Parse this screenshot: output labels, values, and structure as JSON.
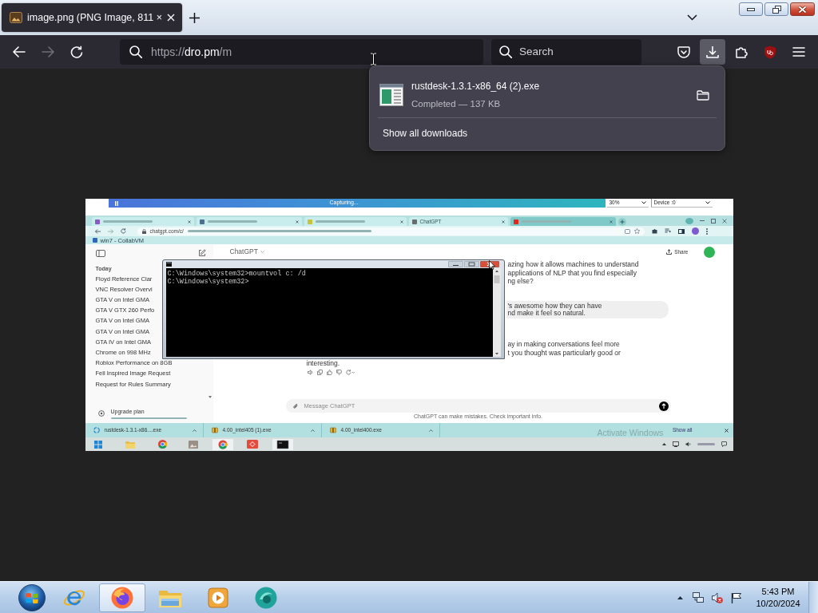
{
  "tab_strip": {
    "tabs": [
      {
        "title": "image.png (PNG Image, 811 ×",
        "selected": true
      }
    ]
  },
  "nav_buttons": [
    {
      "kind": "back",
      "disabled": false
    },
    {
      "kind": "forward",
      "disabled": true
    },
    {
      "kind": "reload",
      "disabled": false
    }
  ],
  "address_bar": {
    "scheme": "https://",
    "host": "dro.pm",
    "path": "/m"
  },
  "search_bar": {
    "placeholder": "Search"
  },
  "toolbar_buttons": [
    {
      "kind": "pocket",
      "selected": false
    },
    {
      "kind": "downloads",
      "selected": true
    },
    {
      "kind": "extensions",
      "selected": false
    },
    {
      "kind": "ublock",
      "selected": false
    },
    {
      "kind": "menu",
      "selected": false
    }
  ],
  "downloads_panel": {
    "items": [
      {
        "filename": "rustdesk-1.3.1-x86_64 (2).exe",
        "status": "Completed — 137 KB"
      }
    ],
    "footer": "Show all downloads"
  },
  "screenshot": {
    "capture_bar": {
      "status": "Capturing...",
      "zoom": "30%",
      "device": "Device :0"
    },
    "browser_tabs": [
      {
        "color": "#8a5bc4",
        "highlighted": false
      },
      {
        "color": "#4f6f8f",
        "highlighted": false
      },
      {
        "color": "#c9c23a",
        "highlighted": false
      },
      {
        "title": "ChatGPT",
        "color": "#6b6b6b",
        "highlighted": false
      },
      {
        "color": "#e0271f",
        "highlighted": true
      }
    ],
    "address": {
      "url": "chatgpt.com/c/"
    },
    "bookmarks": [
      {
        "title": "win7 - CollabVM"
      }
    ],
    "sidebar": {
      "section": "Today",
      "items": [
        "Floyd Reference Clar",
        "VNC Resolver Overvi",
        "GTA V on Intel GMA",
        "GTA V GTX 260 Perfo",
        "GTA V on Intel GMA",
        "GTA V on Intel GMA",
        "GTA IV on Intel GMA",
        "Chrome on 998 MHz",
        "Roblox Performance on 8GB",
        "Fell Inspired Image Request",
        "Request for Rules Summary"
      ],
      "upgrade": "Upgrade plan"
    },
    "chat_header": {
      "title": "ChatGPT",
      "share": "Share"
    },
    "messages": [
      {
        "kind": "assistant",
        "lines": [
          "azing how it allows machines to understand",
          "applications of NLP that you find especially",
          "ng else?"
        ]
      },
      {
        "kind": "user",
        "lines": [
          "'s awesome how they can have",
          "nd make it feel so natural."
        ]
      },
      {
        "kind": "assistant",
        "lines": [
          "ay in making conversations feel more",
          "t you thought was particularly good or"
        ],
        "continuation": "interesting."
      }
    ],
    "composer": {
      "placeholder": "Message ChatGPT"
    },
    "disclaimer": "ChatGPT can make mistakes. Check important info.",
    "console": {
      "lines": [
        "C:\\Windows\\system32>mountvol c: /d",
        "C:\\Windows\\system32>"
      ]
    },
    "download_bar": {
      "items": [
        {
          "filename": "rustdesk-1.3.1-x86....exe",
          "kind": "installer"
        },
        {
          "filename": "4.00_intel405 (1).exe",
          "kind": "archive"
        },
        {
          "filename": "4.00_intel400.exe",
          "kind": "archive"
        }
      ],
      "show_all": "Show all"
    },
    "activation_notice": "Activate Windows"
  },
  "taskbar": {
    "apps": [
      {
        "kind": "ie",
        "selected": false
      },
      {
        "kind": "firefox",
        "selected": true
      },
      {
        "kind": "explorer",
        "selected": false
      },
      {
        "kind": "media",
        "selected": false
      },
      {
        "kind": "swirl",
        "selected": false
      }
    ],
    "clock": {
      "time": "5:43 PM",
      "date": "10/20/2024"
    }
  }
}
